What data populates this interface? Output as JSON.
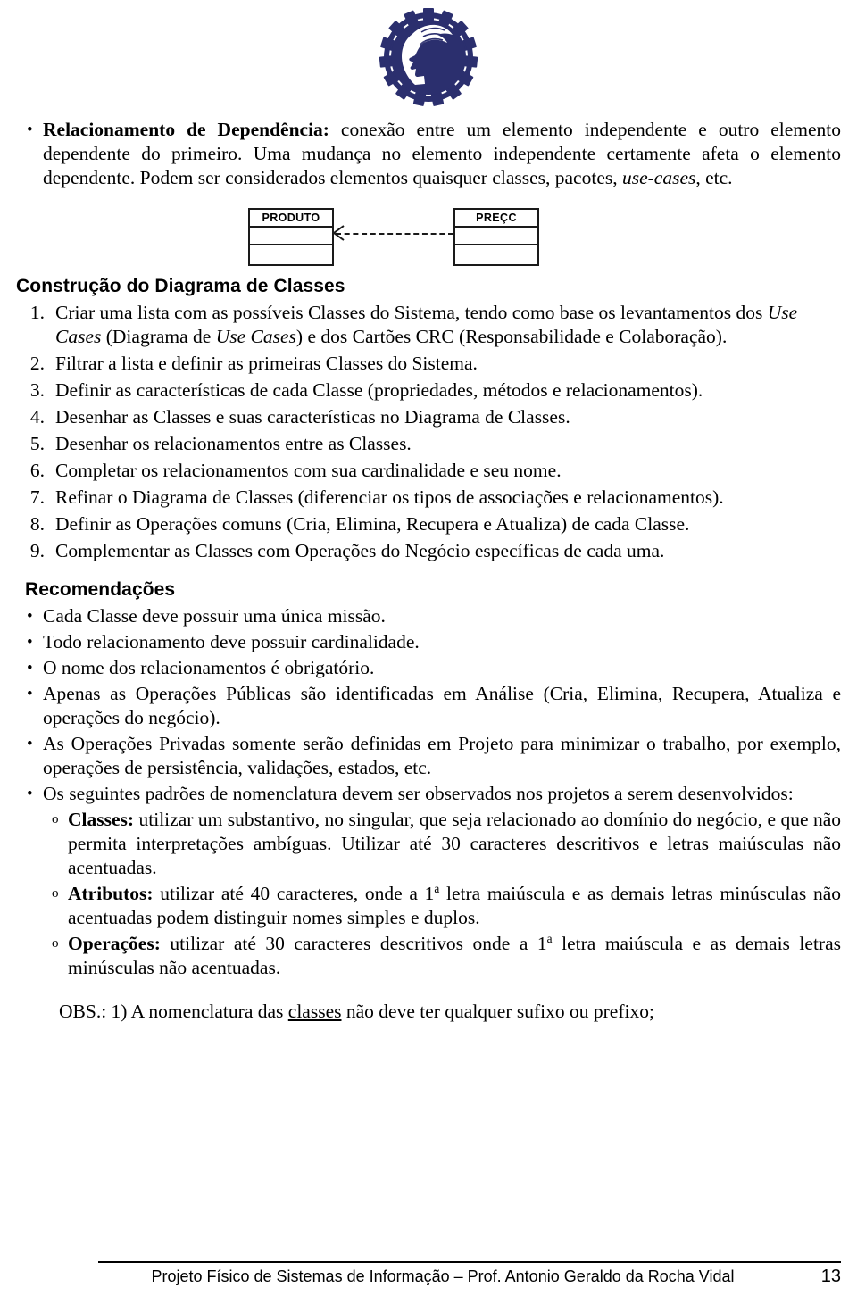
{
  "logo": {
    "name": "institution-gear-head-logo",
    "color": "#2b2f6e"
  },
  "intro_bullet": {
    "marker": "•",
    "bold_lead": "Relacionamento de Dependência:",
    "text_1": " conexão entre um elemento independente e outro elemento dependente do primeiro. Uma mudança no elemento independente certamente afeta o elemento dependente. Podem ser considerados elementos quaisquer classes, pacotes, ",
    "italic_1": "use-cases",
    "text_2": ", etc."
  },
  "uml_diagram": {
    "left_class": "PRODUTO",
    "right_class": "PREÇC",
    "relationship": "dependency-dashed-arrow"
  },
  "section_construcao": {
    "heading": "Construção do Diagrama de Classes",
    "steps": [
      {
        "num": "1.",
        "parts": [
          {
            "t": "Criar uma lista com as possíveis Classes do Sistema, tendo como base os levantamentos dos ",
            "s": "n"
          },
          {
            "t": "Use Cases",
            "s": "i"
          },
          {
            "t": " (Diagrama de ",
            "s": "n"
          },
          {
            "t": "Use Cases",
            "s": "i"
          },
          {
            "t": ") e dos Cartões CRC (Responsabilidade e Colaboração).",
            "s": "n"
          }
        ]
      },
      {
        "num": "2.",
        "parts": [
          {
            "t": "Filtrar a lista e definir as primeiras Classes do Sistema.",
            "s": "n"
          }
        ]
      },
      {
        "num": "3.",
        "parts": [
          {
            "t": "Definir as características de cada Classe (propriedades, métodos e relacionamentos).",
            "s": "n"
          }
        ]
      },
      {
        "num": "4.",
        "parts": [
          {
            "t": "Desenhar as Classes e suas características no Diagrama de Classes.",
            "s": "n"
          }
        ]
      },
      {
        "num": "5.",
        "parts": [
          {
            "t": "Desenhar os relacionamentos entre as Classes.",
            "s": "n"
          }
        ]
      },
      {
        "num": "6.",
        "parts": [
          {
            "t": "Completar os relacionamentos com sua cardinalidade e seu nome.",
            "s": "n"
          }
        ]
      },
      {
        "num": "7.",
        "parts": [
          {
            "t": "Refinar o Diagrama de Classes (diferenciar os tipos de associações e relacionamentos).",
            "s": "n"
          }
        ]
      },
      {
        "num": "8.",
        "parts": [
          {
            "t": "Definir as Operações comuns (Cria, Elimina, Recupera e Atualiza) de cada Classe.",
            "s": "n"
          }
        ]
      },
      {
        "num": "9.",
        "parts": [
          {
            "t": "Complementar as Classes com Operações do Negócio específicas de cada uma.",
            "s": "n"
          }
        ]
      }
    ]
  },
  "section_recomendacoes": {
    "heading": "Recomendações",
    "items": [
      {
        "marker": "•",
        "level": 1,
        "justify": false,
        "parts": [
          {
            "t": "Cada Classe deve possuir uma única missão.",
            "s": "n"
          }
        ]
      },
      {
        "marker": "•",
        "level": 1,
        "justify": false,
        "parts": [
          {
            "t": "Todo relacionamento deve possuir cardinalidade.",
            "s": "n"
          }
        ]
      },
      {
        "marker": "•",
        "level": 1,
        "justify": false,
        "parts": [
          {
            "t": "O nome dos relacionamentos é obrigatório.",
            "s": "n"
          }
        ]
      },
      {
        "marker": "•",
        "level": 1,
        "justify": true,
        "parts": [
          {
            "t": "Apenas as Operações Públicas são identificadas em Análise (Cria, Elimina, Recupera, Atualiza e operações do negócio).",
            "s": "n"
          }
        ]
      },
      {
        "marker": "•",
        "level": 1,
        "justify": true,
        "parts": [
          {
            "t": "As Operações Privadas somente serão definidas em Projeto para minimizar o trabalho, por exemplo, operações de persistência, validações, estados, etc.",
            "s": "n"
          }
        ]
      },
      {
        "marker": "•",
        "level": 1,
        "justify": true,
        "parts": [
          {
            "t": "Os seguintes padrões de nomenclatura devem ser observados nos projetos a serem desenvolvidos:",
            "s": "n"
          }
        ]
      },
      {
        "marker": "o",
        "level": 2,
        "justify": true,
        "parts": [
          {
            "t": "Classes:",
            "s": "b"
          },
          {
            "t": " utilizar um substantivo, no singular, que seja relacionado ao domínio do negócio, e que não permita interpretações ambíguas. Utilizar até 30 caracteres descritivos e letras maiúsculas não acentuadas.",
            "s": "n"
          }
        ]
      },
      {
        "marker": "o",
        "level": 2,
        "justify": true,
        "parts": [
          {
            "t": "Atributos:",
            "s": "b"
          },
          {
            "t": " utilizar até 40 caracteres, onde a 1",
            "s": "n"
          },
          {
            "t": "a",
            "s": "sup"
          },
          {
            "t": " letra maiúscula e as demais letras minúsculas não acentuadas podem distinguir nomes simples e duplos.",
            "s": "n"
          }
        ]
      },
      {
        "marker": "o",
        "level": 2,
        "justify": true,
        "parts": [
          {
            "t": "Operações:",
            "s": "b"
          },
          {
            "t": " utilizar até 30 caracteres descritivos onde a 1",
            "s": "n"
          },
          {
            "t": "a",
            "s": "sup"
          },
          {
            "t": " letra maiúscula e as demais letras minúsculas não acentuadas.",
            "s": "n"
          }
        ]
      }
    ]
  },
  "obs": {
    "parts": [
      {
        "t": "OBS.:  1) A nomenclatura das ",
        "s": "n"
      },
      {
        "t": "classes",
        "s": "u"
      },
      {
        "t": " não deve ter qualquer sufixo ou prefixo;",
        "s": "n"
      }
    ]
  },
  "footer": {
    "text": "Projeto Físico de Sistemas de Informação – Prof. Antonio Geraldo da Rocha Vidal",
    "page": "13"
  }
}
